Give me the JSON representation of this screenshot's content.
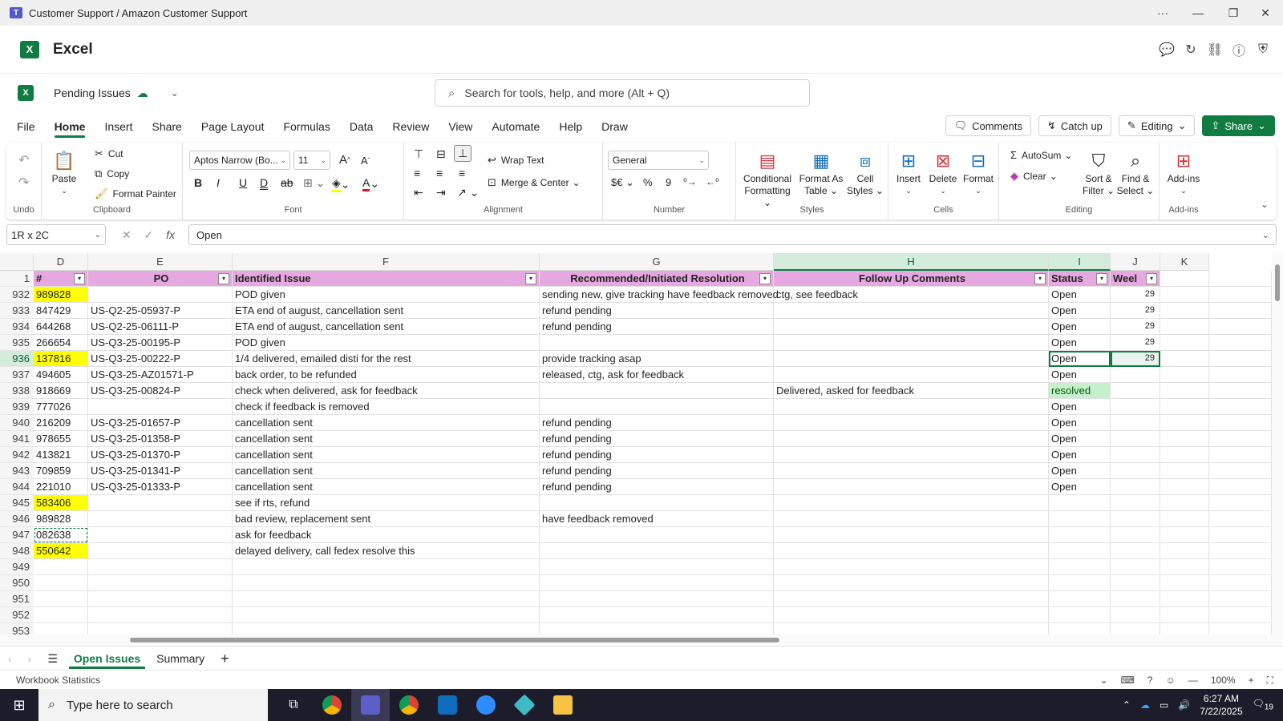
{
  "window": {
    "title": "Customer Support / Amazon Customer Support"
  },
  "app": {
    "name": "Excel"
  },
  "doc": {
    "name": "Pending Issues"
  },
  "search": {
    "placeholder": "Search for tools, help, and more (Alt + Q)"
  },
  "menu": [
    "File",
    "Home",
    "Insert",
    "Share",
    "Page Layout",
    "Formulas",
    "Data",
    "Review",
    "View",
    "Automate",
    "Help",
    "Draw"
  ],
  "actions": {
    "comments": "Comments",
    "catchup": "Catch up",
    "editing": "Editing",
    "share": "Share"
  },
  "ribbon": {
    "undo_label": "Undo",
    "paste": "Paste",
    "cut": "Cut",
    "copy": "Copy",
    "format_painter": "Format Painter",
    "clipboard": "Clipboard",
    "font_name": "Aptos Narrow (Bo...",
    "font_size": "11",
    "font": "Font",
    "wrap_text": "Wrap Text",
    "merge_center": "Merge & Center",
    "alignment": "Alignment",
    "number_format": "General",
    "number": "Number",
    "cond_fmt_1": "Conditional",
    "cond_fmt_2": "Formatting",
    "fmt_table_1": "Format As",
    "fmt_table_2": "Table",
    "cell_styles_1": "Cell",
    "cell_styles_2": "Styles",
    "styles": "Styles",
    "insert": "Insert",
    "delete": "Delete",
    "format": "Format",
    "cells": "Cells",
    "autosum": "AutoSum",
    "clear": "Clear",
    "sort_1": "Sort &",
    "sort_2": "Filter",
    "find_1": "Find &",
    "find_2": "Select",
    "editing": "Editing",
    "addins": "Add-ins",
    "addins_group": "Add-ins"
  },
  "formula_bar": {
    "name_box": "1R x 2C",
    "fx": "fx",
    "value": "Open"
  },
  "columns": [
    {
      "letter": "",
      "name": "col-corner"
    },
    {
      "letter": "D",
      "name": "col-d"
    },
    {
      "letter": "E",
      "name": "col-e"
    },
    {
      "letter": "F",
      "name": "col-f"
    },
    {
      "letter": "G",
      "name": "col-g"
    },
    {
      "letter": "H",
      "name": "col-h"
    },
    {
      "letter": "I",
      "name": "col-i"
    },
    {
      "letter": "J",
      "name": "col-j"
    },
    {
      "letter": "K",
      "name": "col-k"
    }
  ],
  "header_row": {
    "row": "1",
    "cells": [
      "#",
      "PO",
      "Identified Issue",
      "Recommended/Initiated Resolution",
      "Follow Up Comments",
      "Status",
      "Weel"
    ]
  },
  "rows": [
    {
      "row": "932",
      "c": "989828",
      "po": "",
      "issue": "POD given",
      "res": "sending new, give tracking have feedback removed",
      "follow": "ctg, see feedback",
      "status": "Open",
      "week": "29",
      "hl": "yellow"
    },
    {
      "row": "933",
      "c": "847429",
      "po": "US-Q2-25-05937-P",
      "issue": "ETA end of august, cancellation sent",
      "res": "refund pending",
      "follow": "",
      "status": "Open",
      "week": "29",
      "hl": ""
    },
    {
      "row": "934",
      "c": "644268",
      "po": "US-Q2-25-06111-P",
      "issue": "ETA end of august, cancellation sent",
      "res": "refund pending",
      "follow": "",
      "status": "Open",
      "week": "29",
      "hl": ""
    },
    {
      "row": "935",
      "c": "266654",
      "po": "US-Q3-25-00195-P",
      "issue": "POD given",
      "res": "",
      "follow": "",
      "status": "Open",
      "week": "29",
      "hl": ""
    },
    {
      "row": "936",
      "c": "137816",
      "po": "US-Q3-25-00222-P",
      "issue": "1/4 delivered, emailed disti for the rest",
      "res": "provide tracking asap",
      "follow": "",
      "status": "Open",
      "week": "29",
      "hl": "yellow"
    },
    {
      "row": "937",
      "c": "494605",
      "po": "US-Q3-25-AZ01571-P",
      "issue": "back order, to be refunded",
      "res": "released, ctg, ask for feedback",
      "follow": "",
      "status": "Open",
      "week": "",
      "hl": ""
    },
    {
      "row": "938",
      "c": "918669",
      "po": "US-Q3-25-00824-P",
      "issue": "check when delivered, ask for feedback",
      "res": "",
      "follow": "Delivered, asked for feedback",
      "status": "resolved",
      "week": "",
      "hl": ""
    },
    {
      "row": "939",
      "c": "777026",
      "po": "",
      "issue": "check if feedback is removed",
      "res": "",
      "follow": "",
      "status": "Open",
      "week": "",
      "hl": ""
    },
    {
      "row": "940",
      "c": "216209",
      "po": "US-Q3-25-01657-P",
      "issue": "cancellation sent",
      "res": "refund pending",
      "follow": "",
      "status": "Open",
      "week": "",
      "hl": ""
    },
    {
      "row": "941",
      "c": "978655",
      "po": "US-Q3-25-01358-P",
      "issue": "cancellation sent",
      "res": "refund pending",
      "follow": "",
      "status": "Open",
      "week": "",
      "hl": ""
    },
    {
      "row": "942",
      "c": "413821",
      "po": "US-Q3-25-01370-P",
      "issue": "cancellation sent",
      "res": "refund pending",
      "follow": "",
      "status": "Open",
      "week": "",
      "hl": ""
    },
    {
      "row": "943",
      "c": "709859",
      "po": "US-Q3-25-01341-P",
      "issue": "cancellation sent",
      "res": "refund pending",
      "follow": "",
      "status": "Open",
      "week": "",
      "hl": ""
    },
    {
      "row": "944",
      "c": "221010",
      "po": "US-Q3-25-01333-P",
      "issue": "cancellation sent",
      "res": "refund pending",
      "follow": "",
      "status": "Open",
      "week": "",
      "hl": ""
    },
    {
      "row": "945",
      "c": "583406",
      "po": "",
      "issue": "see if rts, refund",
      "res": "",
      "follow": "",
      "status": "",
      "week": "",
      "hl": "yellow"
    },
    {
      "row": "946",
      "c": "989828",
      "po": "",
      "issue": "bad review, replacement sent",
      "res": "have feedback removed",
      "follow": "",
      "status": "",
      "week": "",
      "hl": ""
    },
    {
      "row": "947",
      "c": "082638",
      "po": "",
      "issue": "ask for feedback",
      "res": "",
      "follow": "",
      "status": "",
      "week": "",
      "hl": ""
    },
    {
      "row": "948",
      "c": "550642",
      "po": "",
      "issue": "delayed delivery, call fedex resolve this",
      "res": "",
      "follow": "",
      "status": "",
      "week": "",
      "hl": "yellow"
    },
    {
      "row": "949",
      "c": "",
      "po": "",
      "issue": "",
      "res": "",
      "follow": "",
      "status": "",
      "week": "",
      "hl": ""
    },
    {
      "row": "950",
      "c": "",
      "po": "",
      "issue": "",
      "res": "",
      "follow": "",
      "status": "",
      "week": "",
      "hl": ""
    },
    {
      "row": "951",
      "c": "",
      "po": "",
      "issue": "",
      "res": "",
      "follow": "",
      "status": "",
      "week": "",
      "hl": ""
    },
    {
      "row": "952",
      "c": "",
      "po": "",
      "issue": "",
      "res": "",
      "follow": "",
      "status": "",
      "week": "",
      "hl": ""
    },
    {
      "row": "953",
      "c": "",
      "po": "",
      "issue": "",
      "res": "",
      "follow": "",
      "status": "",
      "week": "",
      "hl": ""
    }
  ],
  "sheets": {
    "active": "Open Issues",
    "other": "Summary"
  },
  "status": {
    "left": "Workbook Statistics",
    "zoom": "100%"
  },
  "taskbar": {
    "search": "Type here to search",
    "time": "6:27 AM",
    "date": "7/22/2025",
    "notif": "19"
  },
  "colors": {
    "accent": "#107c41",
    "header_fill": "#e6a8e0",
    "highlight": "#ffff00",
    "resolved_fill": "#c6efce"
  }
}
